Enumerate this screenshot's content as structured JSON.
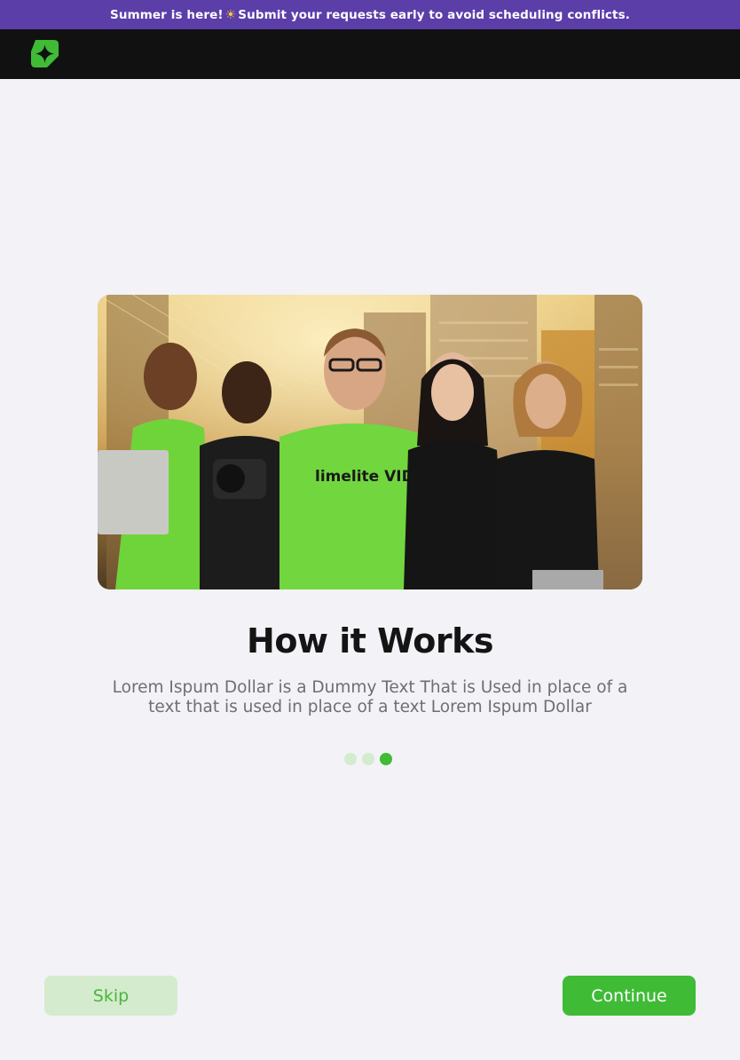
{
  "announcement": {
    "text_before": "Summer is here!",
    "emoji": "☀",
    "text_after": " Submit your requests early to avoid scheduling conflicts."
  },
  "header": {
    "logo_icon": "sparkle-logo-icon",
    "brand_color": "#3fbb36"
  },
  "hero": {
    "image": "team-photo",
    "shirt_text": "limelite VIDEOS"
  },
  "onboarding": {
    "title": "How it Works",
    "description": "Lorem Ispum Dollar is a Dummy Text That is Used in place of a text that is used in place of a text Lorem Ispum Dollar",
    "steps": 3,
    "active_step": 3
  },
  "actions": {
    "skip_label": "Skip",
    "continue_label": "Continue"
  },
  "colors": {
    "announcement_bg": "#5b3ea8",
    "topbar_bg": "#111111",
    "accent": "#3fbb36",
    "accent_light": "#d5ebcd"
  }
}
